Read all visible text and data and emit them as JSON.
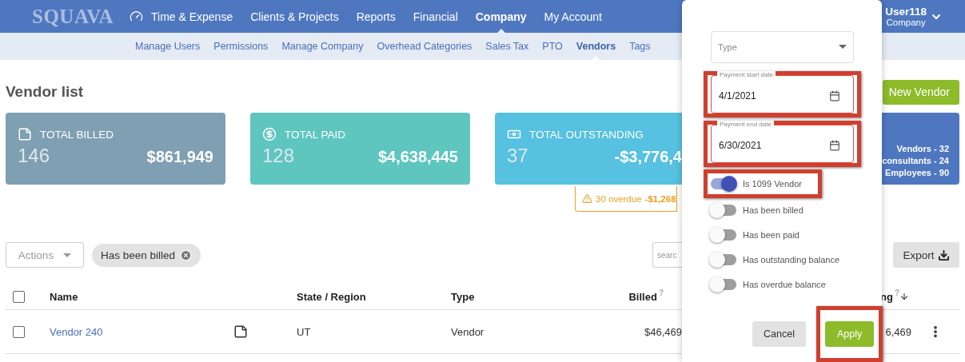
{
  "logo": "SQUAVA",
  "nav": [
    {
      "label": "Time & Expense",
      "selected": false
    },
    {
      "label": "Clients & Projects",
      "selected": false
    },
    {
      "label": "Reports",
      "selected": false
    },
    {
      "label": "Financial",
      "selected": false
    },
    {
      "label": "Company",
      "selected": true
    },
    {
      "label": "My Account",
      "selected": false
    }
  ],
  "user": {
    "name": "User118",
    "role": "Company"
  },
  "subnav": [
    {
      "label": "Manage Users",
      "selected": false
    },
    {
      "label": "Permissions",
      "selected": false
    },
    {
      "label": "Manage Company",
      "selected": false
    },
    {
      "label": "Overhead Categories",
      "selected": false
    },
    {
      "label": "Sales Tax",
      "selected": false
    },
    {
      "label": "PTO",
      "selected": false
    },
    {
      "label": "Vendors",
      "selected": true
    },
    {
      "label": "Tags",
      "selected": false
    }
  ],
  "page_title": "Vendor list",
  "new_button": "New Vendor",
  "summary_cards": [
    {
      "kind": "billed",
      "title": "TOTAL BILLED",
      "count": "146",
      "amount": "$861,949",
      "color": "#7f9fb2"
    },
    {
      "kind": "paid",
      "title": "TOTAL PAID",
      "count": "128",
      "amount": "$4,638,445",
      "color": "#5ec6bf"
    },
    {
      "kind": "outstanding",
      "title": "TOTAL OUTSTANDING",
      "count": "37",
      "amount": "-$3,776,4",
      "color": "#56c1e0"
    }
  ],
  "overdue_notice": {
    "count": "30 overdue",
    "amount": "-$1,268"
  },
  "type_breakdown": [
    "Vendors - 32",
    "consultants - 24",
    "Employees - 90"
  ],
  "actions_dropdown": {
    "label": "Actions"
  },
  "filter_chips": [
    "Has been billed"
  ],
  "search": {
    "placeholder": "searc"
  },
  "export_button": "Export",
  "table": {
    "header_checked": false,
    "columns": [
      {
        "label": "Name"
      },
      {
        "label": "State / Region"
      },
      {
        "label": "Type"
      },
      {
        "label": "Billed",
        "hint": "?"
      },
      {
        "label": "ng",
        "hint": "?",
        "sorted": true
      }
    ],
    "rows": [
      {
        "checked": false,
        "name": "Vendor 240",
        "has_note": true,
        "state": "UT",
        "type": "Vendor",
        "billed": "$46,469",
        "column_5": "6,469"
      }
    ]
  },
  "filter_panel": {
    "type_select": {
      "placeholder": "Type"
    },
    "date_fields": [
      {
        "label": "Payment start date",
        "value": "4/1/2021",
        "highlighted": true
      },
      {
        "label": "Payment end date",
        "value": "6/30/2021",
        "highlighted": true
      }
    ],
    "toggles": [
      {
        "label": "Is 1099 Vendor",
        "on": true,
        "highlighted": true
      },
      {
        "label": "Has been billed",
        "on": false,
        "highlighted": false
      },
      {
        "label": "Has been paid",
        "on": false,
        "highlighted": false
      },
      {
        "label": "Has outstanding balance",
        "on": false,
        "highlighted": false
      },
      {
        "label": "Has overdue balance",
        "on": false,
        "highlighted": false
      }
    ],
    "buttons": [
      {
        "label": "Cancel",
        "kind": "secondary",
        "highlighted": false
      },
      {
        "label": "Apply",
        "kind": "primary",
        "highlighted": true
      }
    ]
  }
}
